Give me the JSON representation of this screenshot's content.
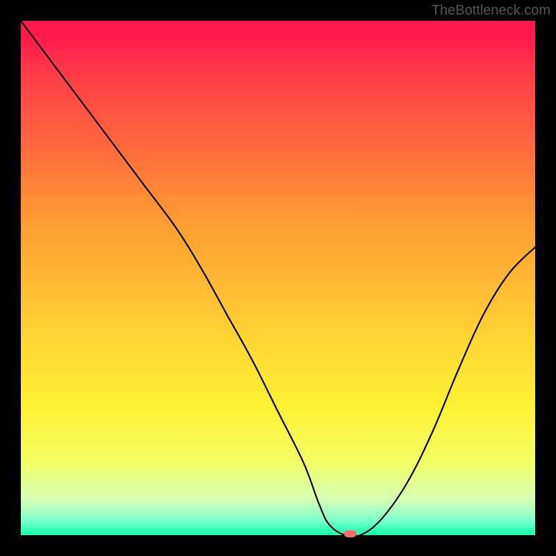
{
  "watermark": "TheBottleneck.com",
  "chart_data": {
    "type": "line",
    "title": "",
    "xlabel": "",
    "ylabel": "",
    "xlim": [
      0,
      100
    ],
    "ylim": [
      0,
      100
    ],
    "grid": false,
    "gradient_background": {
      "top_color": "#ff1a4d",
      "bottom_color": "#1affa8",
      "description": "vertical red-to-green gradient representing bottleneck severity"
    },
    "series": [
      {
        "name": "bottleneck-curve",
        "color": "#000000",
        "x": [
          0,
          6,
          12,
          18,
          24,
          30,
          35,
          40,
          45,
          50,
          55,
          58,
          60,
          63,
          66,
          70,
          75,
          80,
          85,
          90,
          95,
          100
        ],
        "values": [
          100,
          92,
          84,
          76,
          68,
          60,
          52,
          43,
          34,
          24,
          14,
          6,
          2,
          0,
          0,
          3,
          10,
          20,
          32,
          43,
          51,
          56
        ]
      }
    ],
    "marker": {
      "name": "optimal-point",
      "x": 64,
      "y": 0,
      "color": "#ff6b6b",
      "shape": "rounded-rect"
    }
  }
}
